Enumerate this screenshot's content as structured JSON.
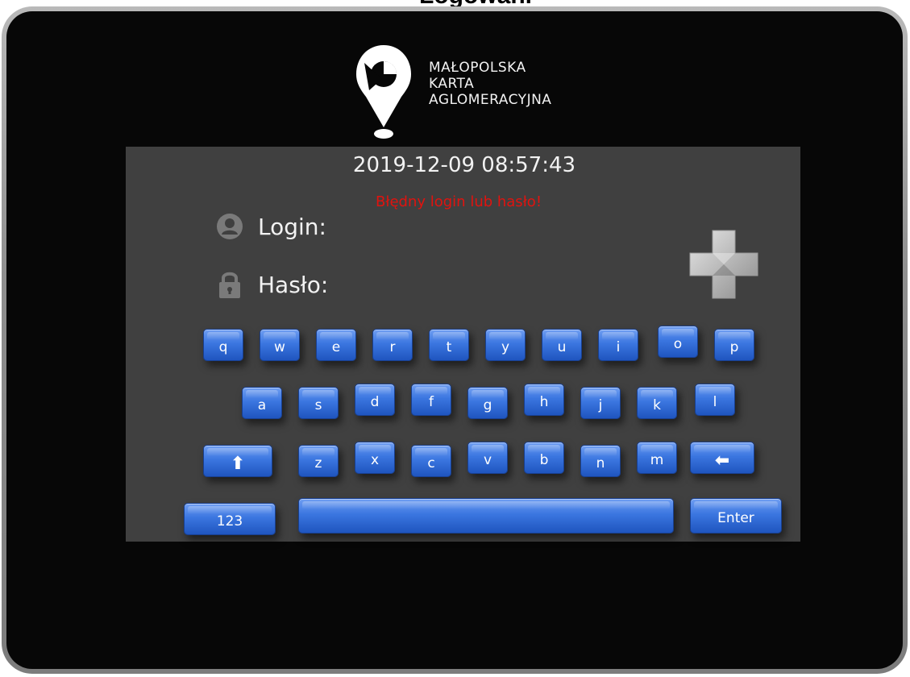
{
  "top_heading": "Logowanie",
  "logo": {
    "lines": [
      "MAŁOPOLSKA",
      "KARTA",
      "AGLOMERACYJNA"
    ]
  },
  "datetime": "2019-12-09 08:57:43",
  "error_message": "Błędny login lub hasło!",
  "fields": {
    "login_label": "Login:",
    "login_value": "",
    "password_label": "Hasło:",
    "password_value": ""
  },
  "icons": {
    "user": "user-icon",
    "lock": "lock-icon",
    "plus": "plus-icon",
    "shift": "shift-arrow-up-icon",
    "backspace": "backspace-arrow-left-icon"
  },
  "keyboard": {
    "row1": [
      "q",
      "w",
      "e",
      "r",
      "t",
      "y",
      "u",
      "i",
      "o",
      "p"
    ],
    "row2": [
      "a",
      "s",
      "d",
      "f",
      "g",
      "h",
      "j",
      "k",
      "l"
    ],
    "row3": [
      "z",
      "x",
      "c",
      "v",
      "b",
      "n",
      "m"
    ],
    "shift_label": "⬆",
    "backspace_label": "⬅",
    "numbers_label": "123",
    "space_label": "",
    "enter_label": "Enter"
  },
  "colors": {
    "key_blue": "#3b76e0",
    "error_red": "#e0130f",
    "panel_gray": "#404040",
    "bezel_black": "#070707"
  }
}
